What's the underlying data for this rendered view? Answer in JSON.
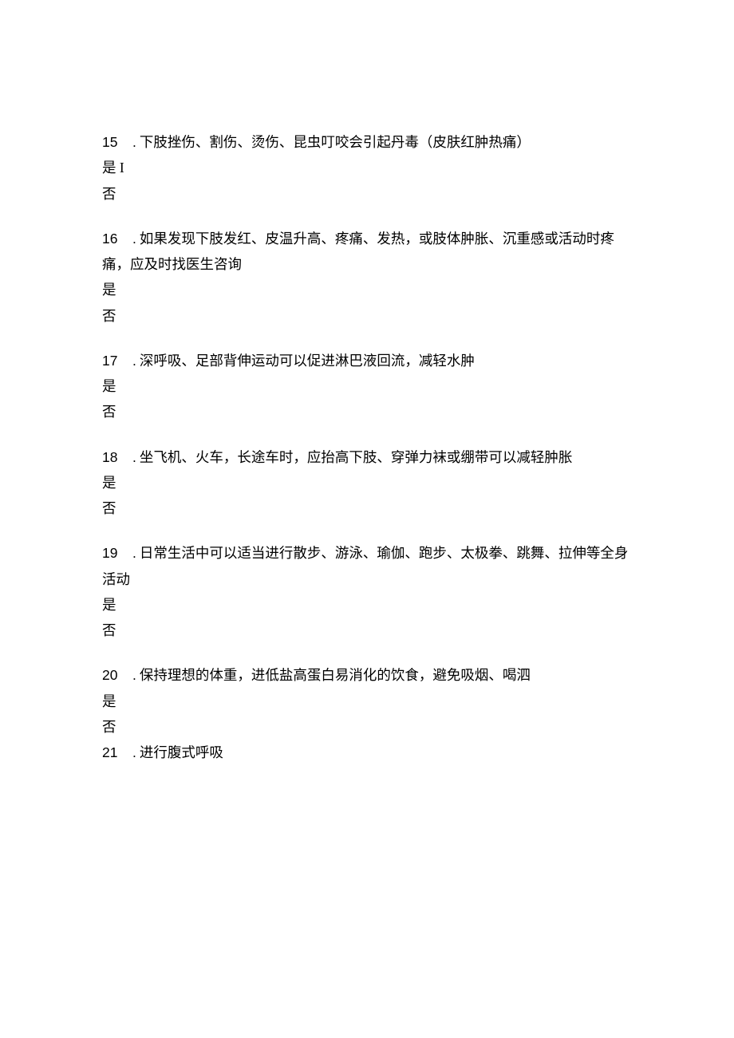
{
  "items": [
    {
      "num": "15",
      "dot": ".",
      "text": "下肢挫伤、割伤、烫伤、昆虫叮咬会引起丹毒（皮肤红肿热痛）",
      "cont": "",
      "yes": "是 I",
      "no": "否"
    },
    {
      "num": "16",
      "dot": ".",
      "text": "如果发现下肢发红、皮温升高、疼痛、发热，或肢体肿胀、沉重感或活动时疼",
      "cont": "痛，应及时找医生咨询",
      "yes": "是",
      "no": "否"
    },
    {
      "num": "17",
      "dot": ".",
      "text": "深呼吸、足部背伸运动可以促进淋巴液回流，减轻水肿",
      "cont": "",
      "yes": "是",
      "no": "否"
    },
    {
      "num": "18",
      "dot": ".",
      "text": "坐飞机、火车，长途车时，应抬高下肢、穿弹力袜或绷带可以减轻肿胀",
      "cont": "",
      "yes": "是",
      "no": "否"
    },
    {
      "num": "19",
      "dot": ".",
      "text": "日常生活中可以适当进行散步、游泳、瑜伽、跑步、太极拳、跳舞、拉伸等全身",
      "cont": "活动",
      "yes": "是",
      "no": "否"
    },
    {
      "num": "20",
      "dot": ".",
      "text": "保持理想的体重，进低盐高蛋白易消化的饮食，避免吸烟、喝泗",
      "cont": "",
      "yes": "是",
      "no": "否"
    },
    {
      "num": "21",
      "dot": ".",
      "text": "进行腹式呼吸",
      "cont": "",
      "yes": "",
      "no": ""
    }
  ]
}
